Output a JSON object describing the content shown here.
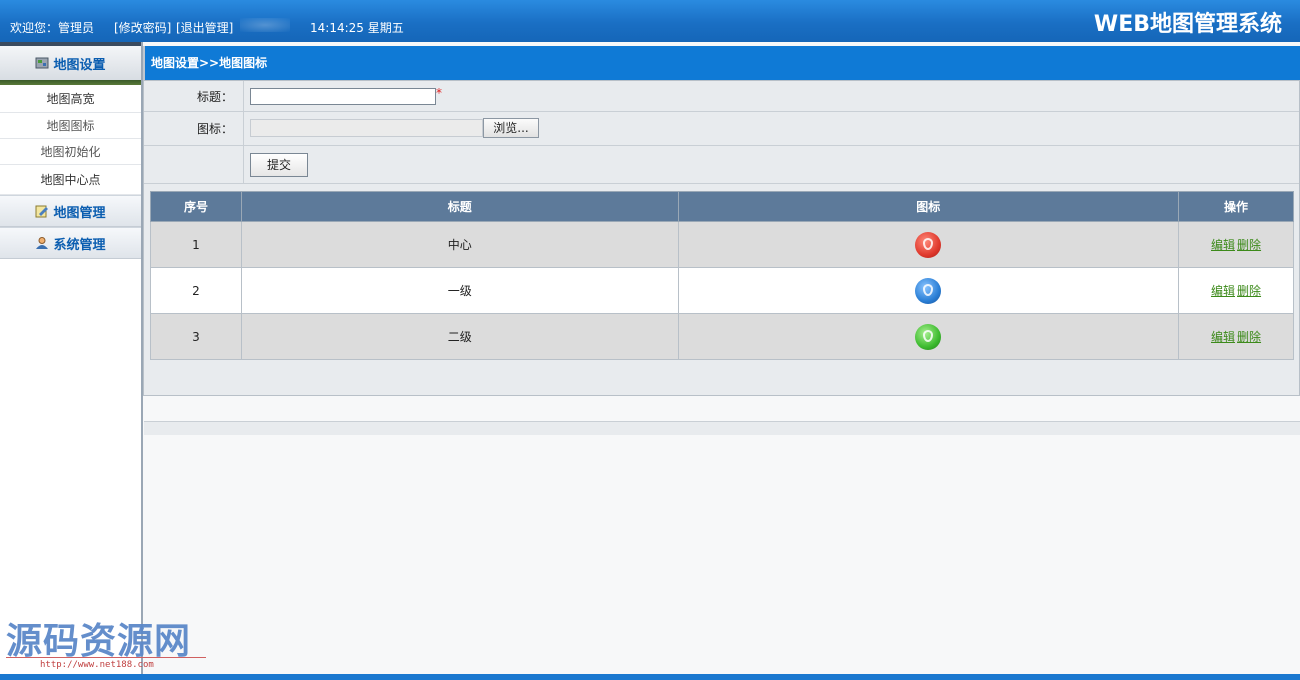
{
  "header": {
    "welcome": "欢迎您：管理员",
    "change_password": "[修改密码]",
    "logout": "[退出管理]",
    "clock": "14:14:25 星期五",
    "brand": "WEB地图管理系统"
  },
  "sidebar": {
    "section_title": "地图设置",
    "items": [
      {
        "label": "地图高宽"
      },
      {
        "label": "地图图标"
      },
      {
        "label": "地图初始化"
      },
      {
        "label": "地图中心点"
      }
    ],
    "groups": [
      {
        "label": "地图管理",
        "icon": "edit-icon"
      },
      {
        "label": "系统管理",
        "icon": "user-icon"
      }
    ]
  },
  "main": {
    "breadcrumb": "地图设置>>地图图标",
    "form": {
      "title_label": "标题：",
      "title_value": "",
      "required_mark": "*",
      "icon_label": "图标：",
      "browse_label": "浏览...",
      "submit_label": "提交"
    },
    "table": {
      "headers": [
        "序号",
        "标题",
        "图标",
        "操作"
      ],
      "rows": [
        {
          "no": "1",
          "title": "中心",
          "icon": "red-anchor-pin-icon",
          "color": "#e03a2e",
          "edit": "编辑",
          "delete": "删除"
        },
        {
          "no": "2",
          "title": "一级",
          "icon": "blue-anchor-pin-icon",
          "color": "#2a7fd6",
          "edit": "编辑",
          "delete": "删除"
        },
        {
          "no": "3",
          "title": "二级",
          "icon": "green-anchor-pin-icon",
          "color": "#3dbb2f",
          "edit": "编辑",
          "delete": "删除"
        }
      ]
    }
  },
  "watermark": {
    "text": "源码资源网",
    "url": "http://www.net188.com"
  },
  "colors": {
    "topbar": "#1a6fc4",
    "breadcrumb_bar": "#0f7ad6",
    "table_header": "#5d7a9a",
    "link_green": "#3c8a1a"
  }
}
